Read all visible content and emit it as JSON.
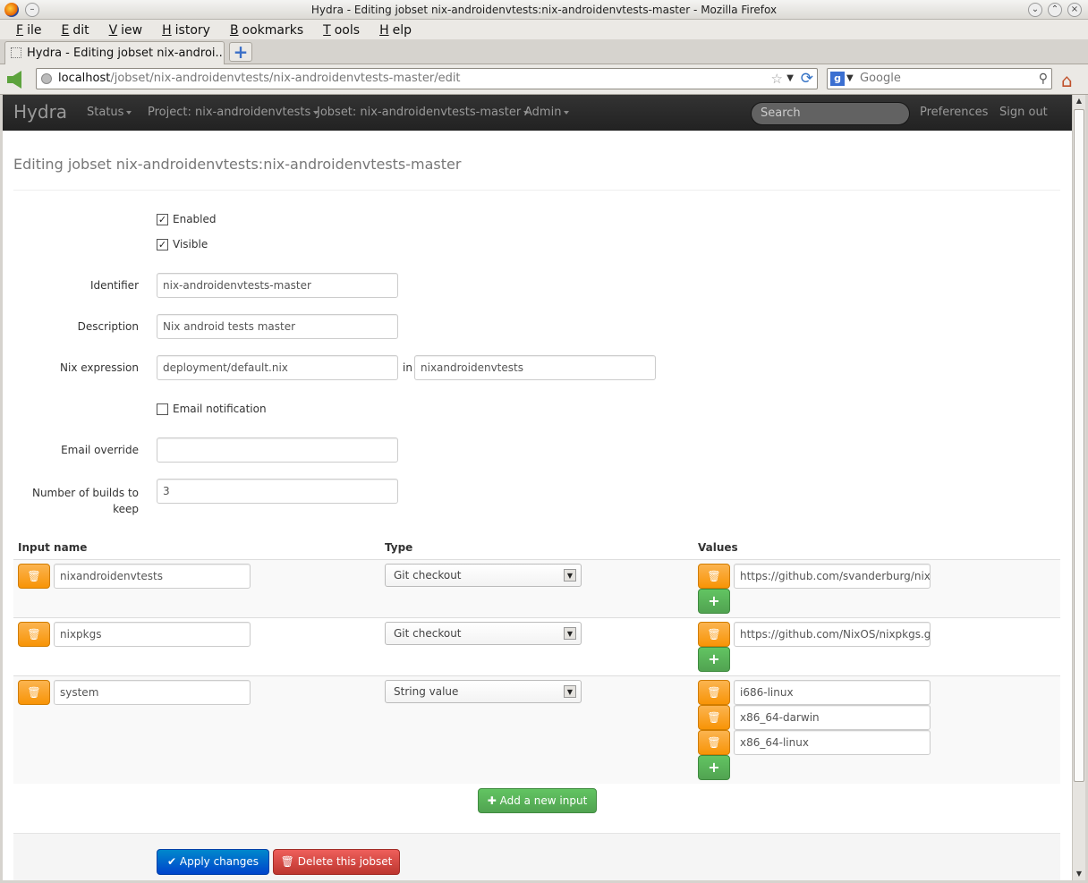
{
  "window": {
    "title": "Hydra - Editing jobset nix-androidenvtests:nix-androidenvtests-master - Mozilla Firefox"
  },
  "menu": [
    {
      "u": "F",
      "rest": "ile"
    },
    {
      "u": "E",
      "rest": "dit"
    },
    {
      "u": "V",
      "rest": "iew"
    },
    {
      "u": "H",
      "rest": "istory"
    },
    {
      "u": "B",
      "rest": "ookmarks"
    },
    {
      "u": "T",
      "rest": "ools"
    },
    {
      "u": "H",
      "rest": "elp"
    }
  ],
  "tab": {
    "label": "Hydra - Editing jobset nix-androi..."
  },
  "url": {
    "host": "localhost",
    "path": "/jobset/nix-androidenvtests/nix-androidenvtests-master/edit"
  },
  "browser_search": {
    "placeholder": "Google"
  },
  "nav": {
    "brand": "Hydra",
    "status": "Status",
    "project": "Project: nix-androidenvtests",
    "jobset": "Jobset: nix-androidenvtests-master",
    "admin": "Admin",
    "search_placeholder": "Search",
    "preferences": "Preferences",
    "signout": "Sign out"
  },
  "page": {
    "title": "Editing jobset nix-androidenvtests:nix-androidenvtests-master"
  },
  "form": {
    "enabled_label": "Enabled",
    "enabled": true,
    "visible_label": "Visible",
    "visible": true,
    "identifier_label": "Identifier",
    "identifier": "nix-androidenvtests-master",
    "description_label": "Description",
    "description": "Nix android tests master",
    "nixexpr_label": "Nix expression",
    "nixexpr_path": "deployment/default.nix",
    "nixexpr_in": "in",
    "nixexpr_input": "nixandroidenvtests",
    "email_notification_label": "Email notification",
    "email_notification": false,
    "email_override_label": "Email override",
    "email_override": "",
    "keep_label_line1": "Number of builds to",
    "keep_label_line2": "keep",
    "keep": "3"
  },
  "inputs_table": {
    "headers": {
      "name": "Input name",
      "type": "Type",
      "values": "Values"
    },
    "rows": [
      {
        "name": "nixandroidenvtests",
        "type": "Git checkout",
        "values": [
          "https://github.com/svanderburg/nix-a"
        ]
      },
      {
        "name": "nixpkgs",
        "type": "Git checkout",
        "values": [
          "https://github.com/NixOS/nixpkgs.gi"
        ]
      },
      {
        "name": "system",
        "type": "String value",
        "values": [
          "i686-linux",
          "x86_64-darwin",
          "x86_64-linux"
        ]
      }
    ]
  },
  "actions": {
    "add_input": "Add a new input",
    "apply": "Apply changes",
    "delete": "Delete this jobset"
  },
  "colors": {
    "navbar": "#222222",
    "warning": "#f89406",
    "success": "#51a351",
    "primary": "#0044cc",
    "danger": "#bd362f"
  }
}
